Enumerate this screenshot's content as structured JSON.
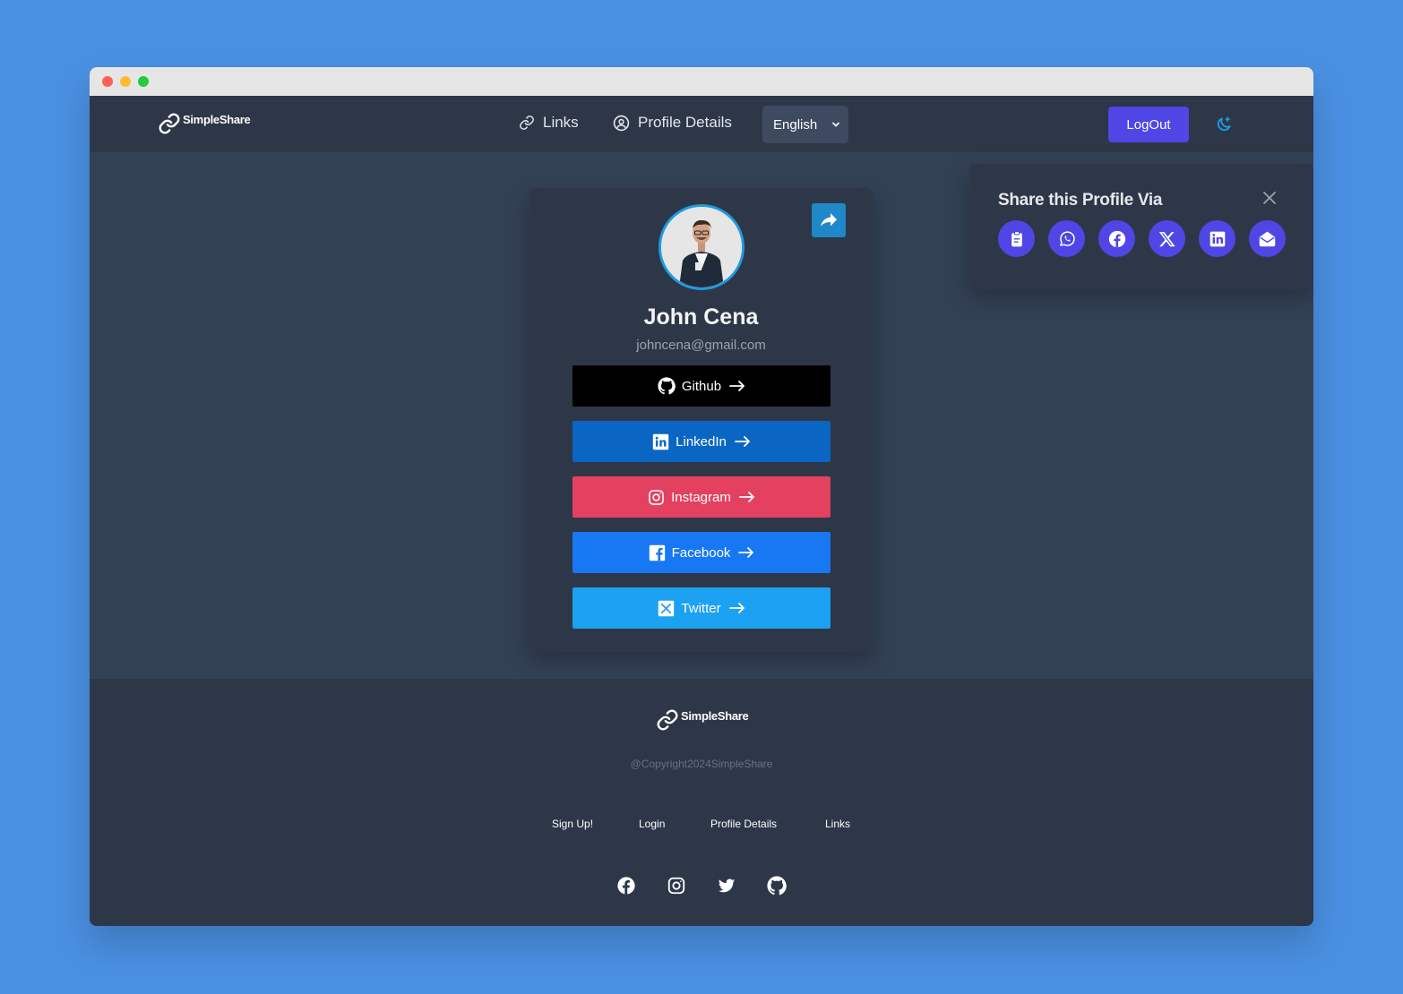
{
  "brand": {
    "name": "SimpleShare"
  },
  "nav": {
    "links_label": "Links",
    "profile_label": "Profile Details",
    "language": "English",
    "logout_label": "LogOut"
  },
  "profile": {
    "name": "John Cena",
    "email": "johncena@gmail.com",
    "links": [
      {
        "label": "Github",
        "color": "#000000"
      },
      {
        "label": "LinkedIn",
        "color": "#0a66c2"
      },
      {
        "label": "Instagram",
        "color": "#e4405f"
      },
      {
        "label": "Facebook",
        "color": "#1877f2"
      },
      {
        "label": "Twitter",
        "color": "#1da1f2"
      }
    ]
  },
  "share_panel": {
    "title": "Share this Profile Via",
    "options": [
      "clipboard-icon",
      "whatsapp-icon",
      "facebook-icon",
      "x-icon",
      "linkedin-icon",
      "email-icon"
    ]
  },
  "footer": {
    "copyright": "@Copyright2024SimpleShare",
    "links": [
      "Sign Up!",
      "Login",
      "Profile Details",
      "Links"
    ],
    "socials": [
      "facebook-icon",
      "instagram-icon",
      "twitter-icon",
      "github-icon"
    ]
  },
  "colors": {
    "accent": "#4f46e5",
    "share_button": "#1e88c8",
    "avatar_ring": "#1e9be0",
    "nav_bg": "#2d3748",
    "main_bg": "#334155"
  }
}
